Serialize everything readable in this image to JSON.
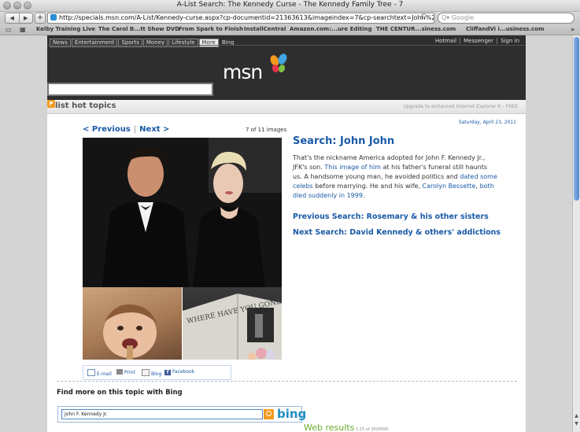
{
  "window": {
    "title": "A-List Search: The Kennedy Curse - The Kennedy Family Tree - 7"
  },
  "toolbar": {
    "back": "◀",
    "forward": "▶",
    "add": "+",
    "url": "http://specials.msn.com/A-List/Kennedy-curse.aspx?cp-documentid=21363613&imageindex=7&cp-searchtext=John%20",
    "reload": "C",
    "search_placeholder": "Q▾ Google"
  },
  "bookmarks": [
    "Kelby Training Live",
    "The Carol B...tt Show DVD",
    "From Spark to Finish",
    "InstallCentral",
    "Amazon.com:...ure Editing",
    "THE CENTUR...siness.com",
    "CliffandVi i...usiness.com"
  ],
  "msn": {
    "nav": [
      "News",
      "Entertainment",
      "Sports",
      "Money",
      "Lifestyle",
      "More"
    ],
    "bing": "Bing",
    "right_links": [
      "Hotmail",
      "Messenger",
      "Sign in"
    ],
    "logo": "msn"
  },
  "hot": {
    "badge": "P",
    "title": "list hot topics",
    "upgrade": "Upgrade to enhanced Internet Explorer 9 – FREE",
    "date": "Saturday, April 23, 2011"
  },
  "gallery": {
    "prev": "< Previous",
    "sep": "|",
    "next": "Next >",
    "count": "7 of 11 images",
    "book_text": "WHERE HAVE YOU GONE"
  },
  "share": {
    "email": "E-mail",
    "print": "Print",
    "blog": "Blog",
    "facebook": "Facebook"
  },
  "article": {
    "title": "Search: John John",
    "p1": "That's the nickname America adopted for John F. Kennedy Jr., JFK's son. ",
    "link1": "This image of him",
    "p2": " at his father's funeral still haunts us. A handsome young man, he avoided politics and ",
    "link2": "dated some celebs",
    "p3": " before marrying. He and his wife, ",
    "link3": "Carolyn Bessette",
    "p4": ", ",
    "link4": "both died suddenly in 1999",
    "p5": ".",
    "prev_search": "Previous Search: Rosemary & his other sisters",
    "next_search": "Next Search: David Kennedy & others' addictions"
  },
  "bing_search": {
    "heading": "Find more on this topic with Bing",
    "query": "John F. Kennedy Jr.",
    "logo": "bing",
    "results_label": "Web results",
    "results_count": "1-15 of 3020000"
  }
}
